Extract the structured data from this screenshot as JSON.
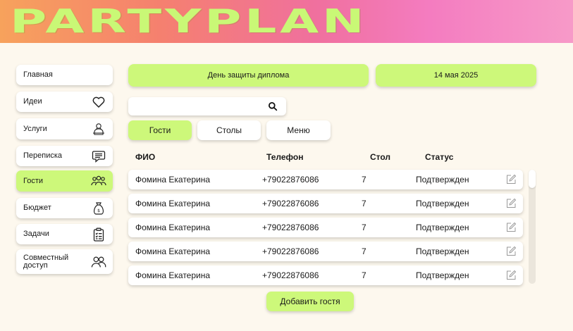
{
  "app": {
    "logo": "PARTYPLAN"
  },
  "sidebar": {
    "items": [
      {
        "label": "Главная",
        "icon": "none"
      },
      {
        "label": "Идеи",
        "icon": "heart-icon"
      },
      {
        "label": "Услуги",
        "icon": "service-icon"
      },
      {
        "label": "Переписка",
        "icon": "chat-icon"
      },
      {
        "label": "Гости",
        "icon": "guests-icon",
        "active": true
      },
      {
        "label": "Бюджет",
        "icon": "money-bag-icon"
      },
      {
        "label": "Задачи",
        "icon": "checklist-icon"
      },
      {
        "label": "Совместный доступ",
        "icon": "shared-users-icon"
      }
    ]
  },
  "event": {
    "name": "День защиты диплома",
    "date": "14 мая 2025"
  },
  "search": {
    "value": "",
    "placeholder": ""
  },
  "tabs": [
    {
      "label": "Гости",
      "active": true
    },
    {
      "label": "Столы"
    },
    {
      "label": "Меню"
    }
  ],
  "table": {
    "headers": {
      "name": "ФИО",
      "phone": "Телефон",
      "table": "Стол",
      "status": "Статус"
    },
    "rows": [
      {
        "name": "Фомина Екатерина",
        "phone": "+79022876086",
        "table": "7",
        "status": "Подтвержден"
      },
      {
        "name": "Фомина Екатерина",
        "phone": "+79022876086",
        "table": "7",
        "status": "Подтвержден"
      },
      {
        "name": "Фомина Екатерина",
        "phone": "+79022876086",
        "table": "7",
        "status": "Подтвержден"
      },
      {
        "name": "Фомина Екатерина",
        "phone": "+79022876086",
        "table": "7",
        "status": "Подтвержден"
      },
      {
        "name": "Фомина Екатерина",
        "phone": "+79022876086",
        "table": "7",
        "status": "Подтвержден"
      }
    ]
  },
  "actions": {
    "add_guest": "Добавить гостя"
  },
  "colors": {
    "accent": "#cdf87a",
    "background": "#fdf8ee",
    "header_gradient_start": "#f7a25c",
    "header_gradient_end": "#f79ac8"
  }
}
